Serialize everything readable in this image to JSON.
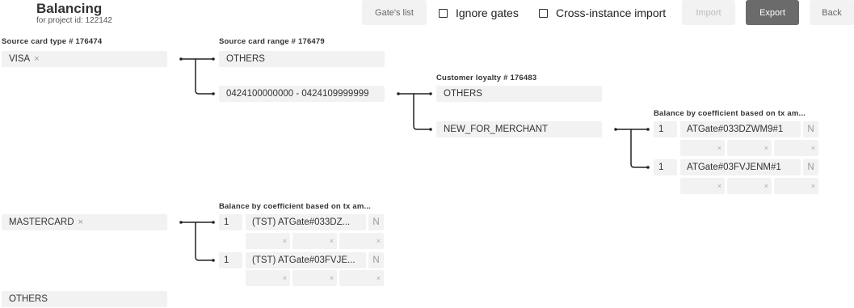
{
  "header": {
    "title": "Balancing",
    "subtitle": "for project id: 122142",
    "gates_list_label": "Gate's list",
    "ignore_gates_label": "Ignore gates",
    "cross_instance_label": "Cross-instance import",
    "import_label": "Import",
    "export_label": "Export",
    "back_label": "Back"
  },
  "labels": {
    "source_card_type": "Source card type # 176474",
    "source_card_range": "Source card range # 176479",
    "customer_loyalty": "Customer loyalty # 176483",
    "balance_coef_1": "Balance by coefficient based on tx am...",
    "balance_coef_2": "Balance by coefficient based on tx am..."
  },
  "card_types": {
    "visa": "VISA",
    "mastercard": "MASTERCARD",
    "others": "OTHERS",
    "remove_symbol": "×"
  },
  "card_ranges": {
    "others": "OTHERS",
    "range": "0424100000000 - 0424109999999"
  },
  "loyalty": {
    "others": "OTHERS",
    "new_for_merchant": "NEW_FOR_MERCHANT"
  },
  "balance_visa": {
    "rows": [
      {
        "coef": "1",
        "gate": "ATGate#033DZWM9#1",
        "n": "N"
      },
      {
        "coef": "1",
        "gate": "ATGate#03FVJENM#1",
        "n": "N"
      }
    ]
  },
  "balance_mastercard": {
    "rows": [
      {
        "coef": "1",
        "gate": "(TST) ATGate#033DZ...",
        "n": "N"
      },
      {
        "coef": "1",
        "gate": "(TST) ATGate#03FVJE...",
        "n": "N"
      }
    ]
  },
  "clear_symbol": "×"
}
